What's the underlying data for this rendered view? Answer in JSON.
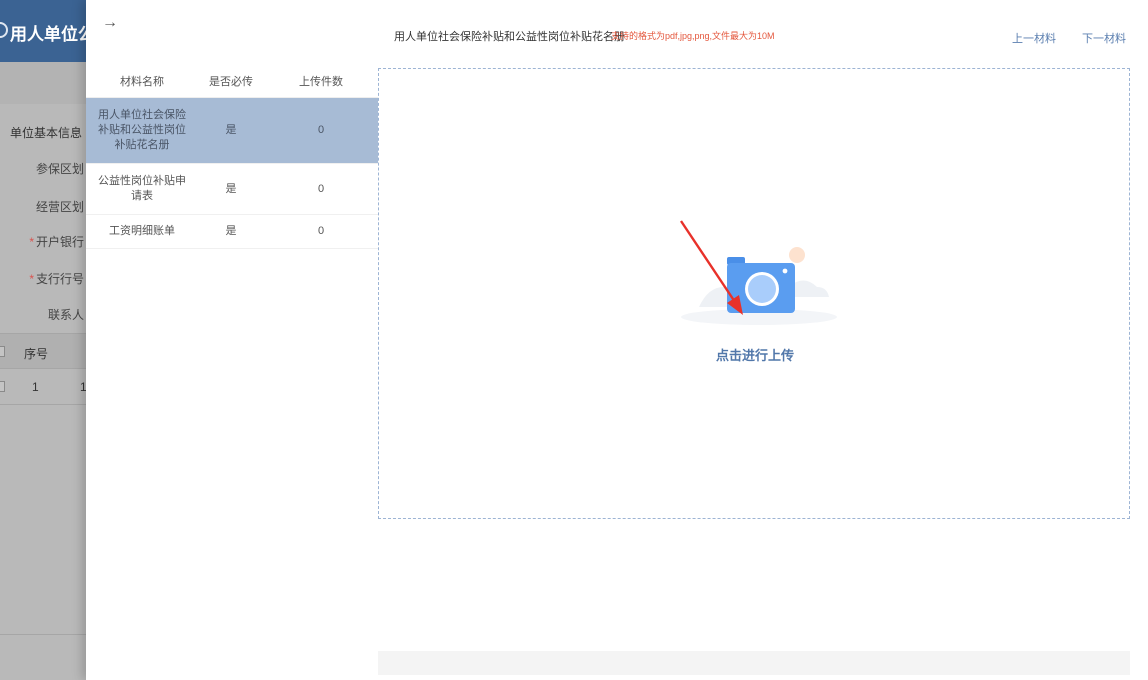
{
  "background_app": {
    "header_title": "用人单位公益",
    "section_title": "单位基本信息",
    "fields": [
      {
        "label": "参保区划",
        "required": false
      },
      {
        "label": "经营区划",
        "required": false
      },
      {
        "label": "开户银行",
        "required": true
      },
      {
        "label": "支行行号",
        "required": true
      },
      {
        "label": "联系人",
        "required": false
      }
    ],
    "table_header": "序号",
    "table_row": {
      "index": "1",
      "trailing": "1"
    }
  },
  "drawer": {
    "back_icon": "arrow-right-icon",
    "back_glyph": "→",
    "columns": {
      "name": "材料名称",
      "required": "是否必传",
      "count": "上传件数"
    },
    "materials": [
      {
        "name": "用人单位社会保险补贴和公益性岗位补贴花名册",
        "required": "是",
        "count": "0",
        "active": true
      },
      {
        "name": "公益性岗位补贴申请表",
        "required": "是",
        "count": "0",
        "active": false
      },
      {
        "name": "工资明细账单",
        "required": "是",
        "count": "0",
        "active": false
      }
    ]
  },
  "upload_panel": {
    "title": "用人单位社会保险补贴和公益性岗位补贴花名册",
    "format_hint": "支持的格式为pdf,jpg,png,文件最大为10M",
    "prev_label": "上一材料",
    "next_label": "下一材料",
    "upload_label": "点击进行上传",
    "upload_icon": "camera-icon"
  },
  "colors": {
    "accent": "#5177aa",
    "active_row": "#a7bbd5",
    "hint_red": "#e4573d",
    "header_blue": "#3b6393",
    "camera_blue": "#4a8fe8",
    "arrow_red": "#e8312a"
  }
}
